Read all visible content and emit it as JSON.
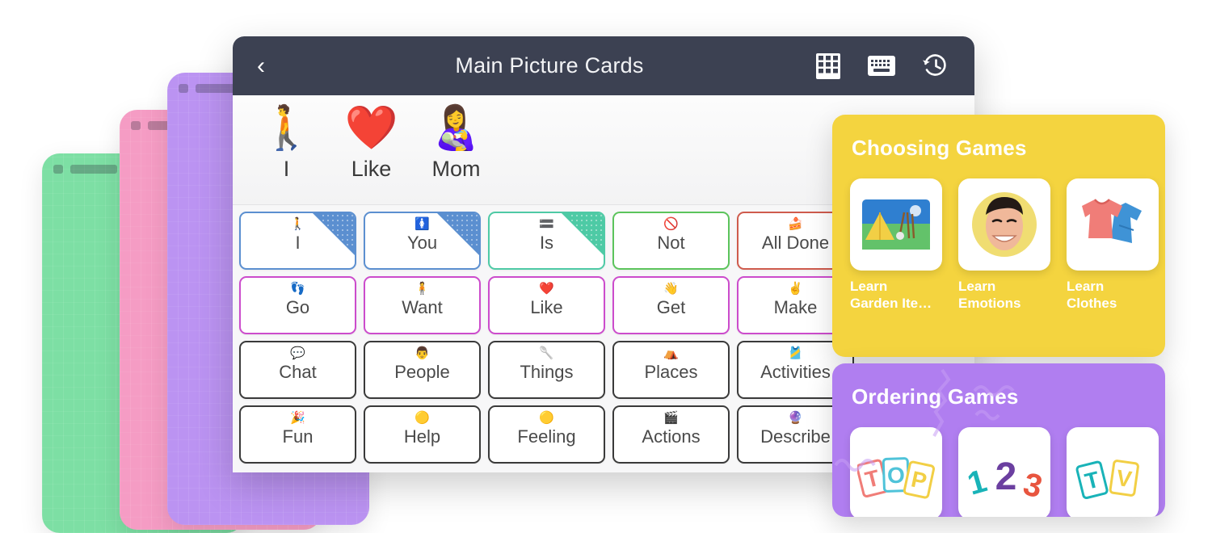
{
  "window": {
    "header": {
      "back_icon": "chevron-left-icon",
      "title": "Main Picture Cards",
      "actions": [
        {
          "name": "grid-view-icon",
          "label": "Grid view"
        },
        {
          "name": "keyboard-icon",
          "label": "Keyboard"
        },
        {
          "name": "history-icon",
          "label": "History"
        }
      ]
    },
    "sentence_strip": {
      "words": [
        {
          "label": "I",
          "emoji": "🚶",
          "icon_name": "person-walking-icon"
        },
        {
          "label": "Like",
          "emoji": "❤️",
          "icon_name": "heart-icon"
        },
        {
          "label": "Mom",
          "emoji": "👩‍🍼",
          "icon_name": "mother-and-baby-icon"
        }
      ]
    },
    "grid": {
      "rows": [
        [
          {
            "label": "I",
            "icon": "🚶",
            "icon_name": "person-icon",
            "color": "#5b8fd0",
            "corner": true
          },
          {
            "label": "You",
            "icon": "🚺",
            "icon_name": "person-pointing-icon",
            "color": "#5b8fd0",
            "corner": true
          },
          {
            "label": "Is",
            "icon": "🟰",
            "icon_name": "equals-icon",
            "color": "#4ecaa5",
            "corner": true
          },
          {
            "label": "Not",
            "icon": "🚫",
            "icon_name": "prohibited-icon",
            "color": "#5cc45c",
            "corner": false
          },
          {
            "label": "All Done",
            "icon": "🍰",
            "icon_name": "all-done-icon",
            "color": "#cf5b4d",
            "corner": false
          }
        ],
        [
          {
            "label": "Go",
            "icon": "👣",
            "icon_name": "footprints-icon",
            "color": "#cc4ccc",
            "corner": false
          },
          {
            "label": "Want",
            "icon": "🧍",
            "icon_name": "standing-person-icon",
            "color": "#cc4ccc",
            "corner": false
          },
          {
            "label": "Like",
            "icon": "❤️",
            "icon_name": "heart-icon",
            "color": "#cc4ccc",
            "corner": false
          },
          {
            "label": "Get",
            "icon": "👋",
            "icon_name": "reaching-hand-icon",
            "color": "#cc4ccc",
            "corner": false
          },
          {
            "label": "Make",
            "icon": "✌️",
            "icon_name": "hand-icon",
            "color": "#cc4ccc",
            "corner": false
          }
        ],
        [
          {
            "label": "Chat",
            "icon": "💬",
            "icon_name": "speech-bubble-icon",
            "color": "#3a3a3a",
            "corner": false
          },
          {
            "label": "People",
            "icon": "👨",
            "icon_name": "people-icon",
            "color": "#3a3a3a",
            "corner": false
          },
          {
            "label": "Things",
            "icon": "🥄",
            "icon_name": "object-icon",
            "color": "#3a3a3a",
            "corner": false
          },
          {
            "label": "Places",
            "icon": "⛺",
            "icon_name": "tent-icon",
            "color": "#3a3a3a",
            "corner": false
          },
          {
            "label": "Activities",
            "icon": "🎽",
            "icon_name": "activities-icon",
            "color": "#3a3a3a",
            "corner": false
          }
        ],
        [
          {
            "label": "Fun",
            "icon": "🎉",
            "icon_name": "party-popper-icon",
            "color": "#3a3a3a",
            "corner": false
          },
          {
            "label": "Help",
            "icon": "🟡",
            "icon_name": "help-ring-icon",
            "color": "#3a3a3a",
            "corner": false
          },
          {
            "label": "Feeling",
            "icon": "🟡",
            "icon_name": "emotion-face-icon",
            "color": "#3a3a3a",
            "corner": false
          },
          {
            "label": "Actions",
            "icon": "🎬",
            "icon_name": "clapperboard-icon",
            "color": "#3a3a3a",
            "corner": false
          },
          {
            "label": "Describe",
            "icon": "🔮",
            "icon_name": "describe-icon",
            "color": "#3a3a3a",
            "corner": false
          }
        ]
      ]
    }
  },
  "games": {
    "panels": [
      {
        "title": "Choosing Games",
        "color": "#f4d43f",
        "tiles": [
          {
            "label": "Learn\nGarden Ite…",
            "thumb_name": "garden-tent-thumbnail"
          },
          {
            "label": "Learn\nEmotions",
            "thumb_name": "smiling-face-thumbnail"
          },
          {
            "label": "Learn\nClothes",
            "thumb_name": "tshirt-jeans-thumbnail"
          }
        ]
      },
      {
        "title": "Ordering Games",
        "color": "#b07ef0",
        "tiles": [
          {
            "label": "",
            "thumb_name": "letter-cards-thumbnail"
          },
          {
            "label": "",
            "thumb_name": "number-cards-thumbnail"
          },
          {
            "label": "",
            "thumb_name": "alphabet-cards-thumbnail"
          }
        ]
      }
    ]
  },
  "background_stack": [
    {
      "name": "stack-card-green",
      "color": "#7ddfa4"
    },
    {
      "name": "stack-card-pink",
      "color": "#f59cc4"
    },
    {
      "name": "stack-card-purple",
      "color": "#bb93f2"
    }
  ]
}
